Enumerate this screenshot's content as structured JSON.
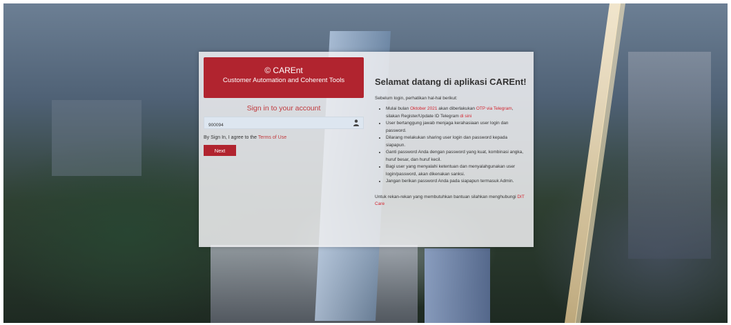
{
  "colors": {
    "brand_red": "#b1242f",
    "link_red": "#d3242e"
  },
  "brand": {
    "title": "© CAREnt",
    "subtitle": "Customer Automation and Coherent Tools"
  },
  "signin": {
    "title": "Sign in to your account",
    "username_value": "900094",
    "user_icon": "user-icon",
    "agree_text": "By Sign In, I agree to the ",
    "terms_link": "Terms of Use",
    "next_label": "Next"
  },
  "info": {
    "welcome": "Selamat datang di aplikasi CAREnt!",
    "intro": "Sebelum login, perhatikan hal-hal berikut:",
    "rule1": {
      "p1": "Mulai bulan ",
      "p2": "Oktober 2021",
      "p3": " akan diberlakukan ",
      "p4": "OTP via Telegram",
      "p5": ", silakan Register/Update ID Telegram ",
      "p6": "di sini"
    },
    "rules": [
      "User bertanggung jawab menjaga kerahasiaan user login dan password.",
      "Dilarang melakukan sharing user login dan password kepada siapapun.",
      "Ganti password Anda dengan password yang kuat, kombinasi angka, huruf besar, dan huruf kecil.",
      "Bagi user yang menyalahi ketentuan dan menyalahgunakan user login/password, akan dikenakan sanksi.",
      "Jangan berikan password Anda pada siapapun termasuk Admin."
    ],
    "contact_text": "Untuk rekan-rekan yang membutuhkan bantuan silahkan menghubungi ",
    "contact_link": "DIT Care"
  }
}
